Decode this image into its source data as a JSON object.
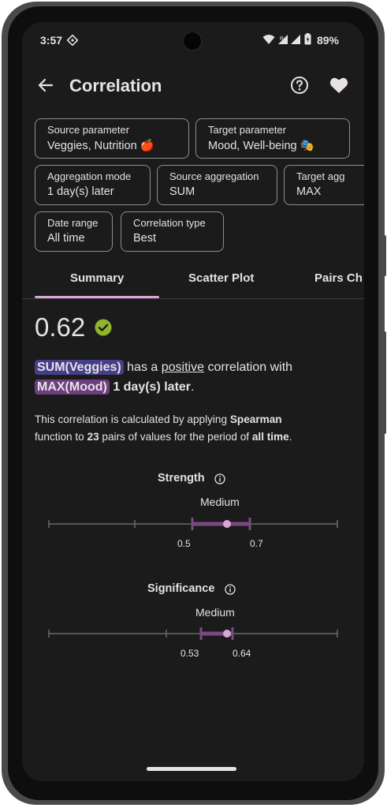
{
  "status_bar": {
    "time": "3:57",
    "battery": "89%"
  },
  "header": {
    "title": "Correlation",
    "back_icon": "arrow-left-icon",
    "help_icon": "help-circle-icon",
    "favorite_icon": "heart-icon"
  },
  "filters": [
    {
      "label": "Source parameter",
      "value": "Veggies, Nutrition 🍎"
    },
    {
      "label": "Target parameter",
      "value": "Mood, Well-being 🎭"
    },
    {
      "label": "Aggregation mode",
      "value": "1 day(s) later"
    },
    {
      "label": "Source aggregation",
      "value": "SUM"
    },
    {
      "label": "Target agg",
      "value": "MAX"
    },
    {
      "label": "Date range",
      "value": "All time"
    },
    {
      "label": "Correlation type",
      "value": "Best"
    }
  ],
  "tabs": [
    "Summary",
    "Scatter Plot",
    "Pairs Ch"
  ],
  "summary": {
    "value": "0.62",
    "source_pill": "SUM(Veggies)",
    "has_a": "has a",
    "direction": "positive",
    "correlation_with": "correlation with",
    "target_pill": "MAX(Mood)",
    "lag": "1 day(s) later",
    "period_char": ".",
    "desc_1": "This correlation is calculated by applying",
    "method": "Spearman",
    "desc_2": "function to",
    "pairs": "23",
    "desc_3": "pairs of values for the period of",
    "period": "all time",
    "desc_end": "."
  },
  "strength": {
    "title": "Strength",
    "level": "Medium",
    "low_label": "0.5",
    "high_label": "0.7",
    "value": 0.62,
    "low": 0.5,
    "high": 0.7,
    "min": 0,
    "max": 1,
    "ticks": [
      0,
      0.3,
      0.5,
      0.7,
      1
    ]
  },
  "significance": {
    "title": "Significance",
    "level": "Medium",
    "low_label": "0.53",
    "high_label": "0.64",
    "value": 0.62,
    "low": 0.53,
    "high": 0.64
  },
  "colors": {
    "accent": "#d7a7d8",
    "range": "#7a4a80",
    "check": "#8fb62c",
    "source_pill": "#453f88",
    "target_pill": "#6e3f7e"
  }
}
